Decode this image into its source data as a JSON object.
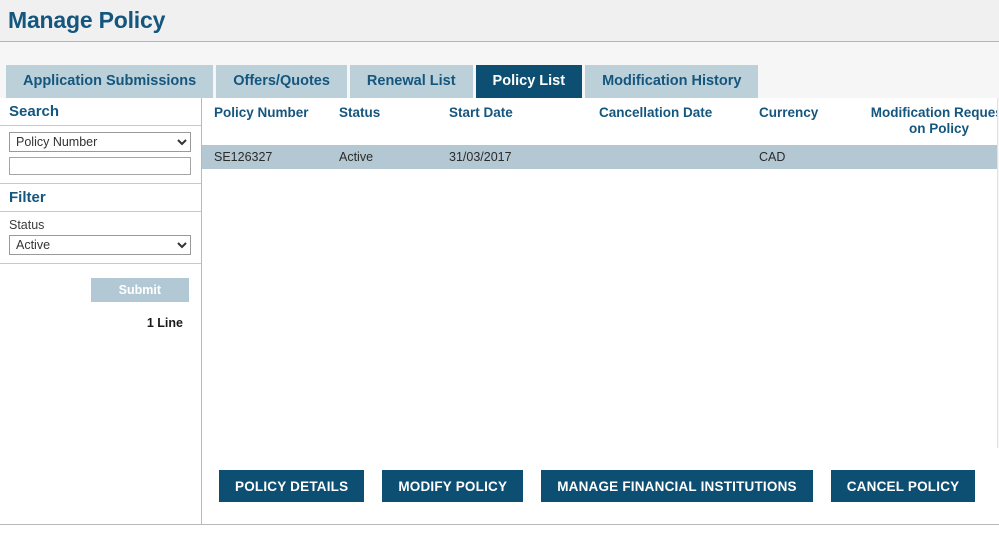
{
  "header": {
    "title": "Manage Policy"
  },
  "tabs": [
    {
      "label": "Application Submissions",
      "active": false
    },
    {
      "label": "Offers/Quotes",
      "active": false
    },
    {
      "label": "Renewal List",
      "active": false
    },
    {
      "label": "Policy List",
      "active": true
    },
    {
      "label": "Modification History",
      "active": false
    }
  ],
  "sidebar": {
    "search": {
      "heading": "Search",
      "criteria_selected": "Policy Number",
      "criteria_options": [
        "Policy Number"
      ],
      "query_value": "",
      "query_placeholder": ""
    },
    "filter": {
      "heading": "Filter",
      "status_label": "Status",
      "status_selected": "Active",
      "status_options": [
        "Active"
      ]
    },
    "submit_label": "Submit",
    "line_count": "1 Line"
  },
  "table": {
    "columns": [
      "Policy Number",
      "Status",
      "Start Date",
      "Cancellation Date",
      "Currency",
      "Modification Request on Policy"
    ],
    "rows": [
      {
        "policy_number": "SE126327",
        "status": "Active",
        "start_date": "31/03/2017",
        "cancellation_date": "",
        "currency": "CAD",
        "modification_request": "",
        "selected": true
      }
    ]
  },
  "scrollbar": {
    "up_icon": "chevron-up-icon",
    "down_icon": "chevron-down-icon"
  },
  "actions": [
    {
      "label": "POLICY DETAILS",
      "name": "policy-details-button"
    },
    {
      "label": "MODIFY POLICY",
      "name": "modify-policy-button"
    },
    {
      "label": "MANAGE FINANCIAL INSTITUTIONS",
      "name": "manage-financial-institutions-button"
    },
    {
      "label": "CANCEL POLICY",
      "name": "cancel-policy-button"
    }
  ],
  "colors": {
    "brand_dark": "#0d4f73",
    "brand_text": "#14567e",
    "tab_inactive": "#bcd0d9",
    "row_selected": "#b4c8d3",
    "submit_disabled": "#b2c9d5"
  }
}
